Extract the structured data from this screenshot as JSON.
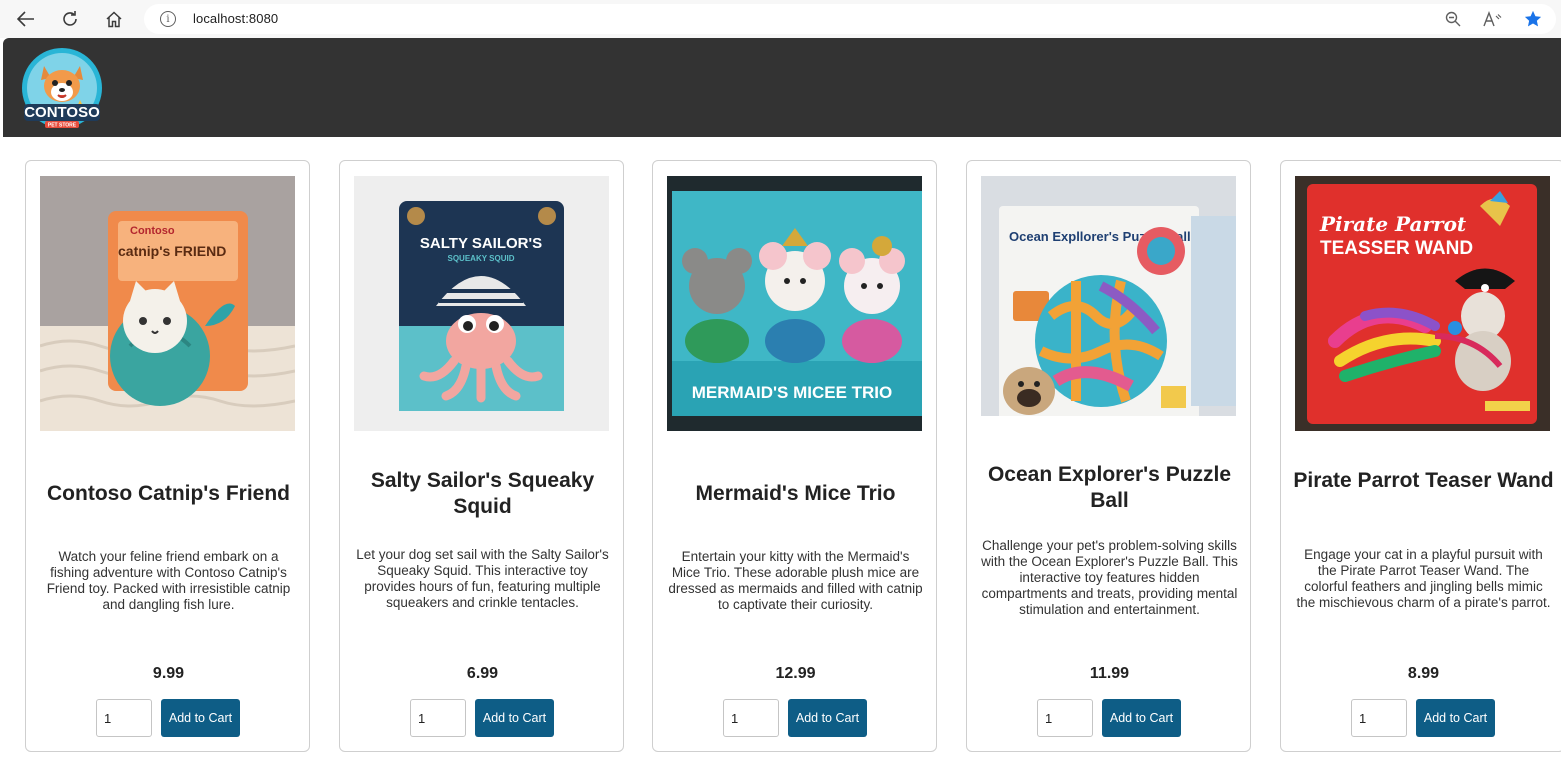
{
  "browser": {
    "url": "localhost:8080",
    "info_glyph": "i"
  },
  "header": {
    "logo_text": "CONTOSO",
    "logo_subtext": "PET STORE"
  },
  "products": [
    {
      "title": "Contoso Catnip's Friend",
      "description": "Watch your feline friend embark on a fishing adventure with Contoso Catnip's Friend toy. Packed with irresistible catnip and dangling fish lure.",
      "price": "9.99",
      "quantity": "1",
      "button_label": "Add to Cart",
      "image": {
        "package_text": "catnip's FRIEND",
        "brand": "Contoso"
      }
    },
    {
      "title": "Salty Sailor's Squeaky Squid",
      "description": "Let your dog set sail with the Salty Sailor's Squeaky Squid. This interactive toy provides hours of fun, featuring multiple squeakers and crinkle tentacles.",
      "price": "6.99",
      "quantity": "1",
      "button_label": "Add to Cart",
      "image": {
        "package_text": "SALTY SAILOR'S",
        "package_subtext": "SQUEAKY SQUID"
      }
    },
    {
      "title": "Mermaid's Mice Trio",
      "description": "Entertain your kitty with the Mermaid's Mice Trio. These adorable plush mice are dressed as mermaids and filled with catnip to captivate their curiosity.",
      "price": "12.99",
      "quantity": "1",
      "button_label": "Add to Cart",
      "image": {
        "package_text": "MERMAID'S MICEE TRIO"
      }
    },
    {
      "title": "Ocean Explorer's Puzzle Ball",
      "description": "Challenge your pet's problem-solving skills with the Ocean Explorer's Puzzle Ball. This interactive toy features hidden compartments and treats, providing mental stimulation and entertainment.",
      "price": "11.99",
      "quantity": "1",
      "button_label": "Add to Cart",
      "image": {
        "package_text": "Ocean Expllorer's Puzzle Ball"
      }
    },
    {
      "title": "Pirate Parrot Teaser Wand",
      "description": "Engage your cat in a playful pursuit with the Pirate Parrot Teaser Wand. The colorful feathers and jingling bells mimic the mischievous charm of a pirate's parrot.",
      "price": "8.99",
      "quantity": "1",
      "button_label": "Add to Cart",
      "image": {
        "package_text": "Pirate Parrot",
        "package_subtext": "TEASSER WAND"
      }
    }
  ],
  "colors": {
    "header_bg": "#333333",
    "button_bg": "#0e5d86",
    "accent_star": "#1a73e8"
  }
}
